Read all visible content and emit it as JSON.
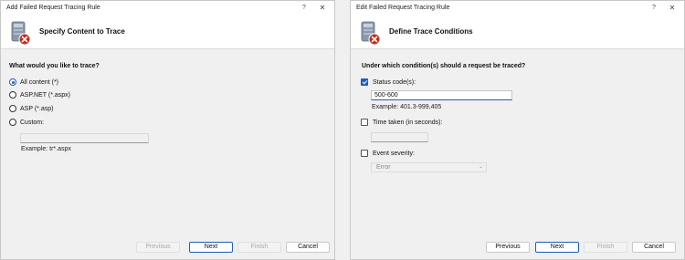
{
  "left_dialog": {
    "title": "Add Failed Request Tracing Rule",
    "help_glyph": "?",
    "close_glyph": "✕",
    "header_title": "Specify Content to Trace",
    "question": "What would you like to trace?",
    "options": [
      {
        "label": "All content (*)",
        "checked": true
      },
      {
        "label": "ASP.NET (*.aspx)",
        "checked": false
      },
      {
        "label": "ASP (*.asp)",
        "checked": false
      },
      {
        "label": "Custom:",
        "checked": false
      }
    ],
    "custom_value": "",
    "example": "Example: tr*.aspx",
    "buttons": {
      "previous": "Previous",
      "next": "Next",
      "finish": "Finish",
      "cancel": "Cancel"
    }
  },
  "right_dialog": {
    "title": "Edit Failed Request Tracing Rule",
    "help_glyph": "?",
    "close_glyph": "✕",
    "header_title": "Define Trace Conditions",
    "question": "Under which condition(s) should a request be traced?",
    "status_codes": {
      "label": "Status code(s):",
      "checked": true,
      "value": "500-600",
      "example": "Example: 401.3-999,405"
    },
    "time_taken": {
      "label": "Time taken (in seconds):",
      "checked": false,
      "value": ""
    },
    "event_severity": {
      "label": "Event severity:",
      "checked": false,
      "selected": "Error",
      "arrow": "⌄"
    },
    "buttons": {
      "previous": "Previous",
      "next": "Next",
      "finish": "Finish",
      "cancel": "Cancel"
    }
  },
  "colors": {
    "accent": "#1f5cb8",
    "error_badge": "#c42b1c",
    "icon_body": "#7f8ea3"
  }
}
